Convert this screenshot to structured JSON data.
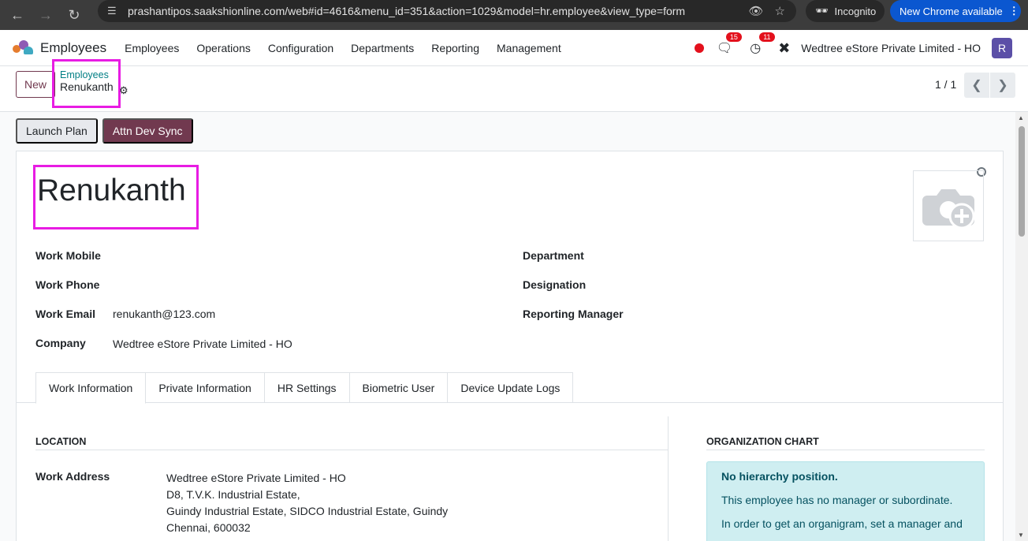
{
  "browser": {
    "url": "prashantipos.saakshionline.com/web#id=4616&menu_id=351&action=1029&model=hr.employee&view_type=form",
    "incognito_label": "Incognito",
    "update_label": "New Chrome available"
  },
  "topnav": {
    "app_name": "Employees",
    "menu": [
      "Employees",
      "Operations",
      "Configuration",
      "Departments",
      "Reporting",
      "Management"
    ],
    "messages_count": "15",
    "activities_count": "11",
    "company": "Wedtree eStore Private Limited - HO",
    "avatar_letter": "R"
  },
  "control_panel": {
    "new_label": "New",
    "breadcrumb_parent": "Employees",
    "breadcrumb_current": "Renukanth",
    "pager": "1 / 1"
  },
  "actions": {
    "launch_plan": "Launch Plan",
    "attn_dev_sync": "Attn Dev Sync"
  },
  "employee": {
    "name": "Renukanth",
    "fields_left": [
      {
        "label": "Work Mobile",
        "value": ""
      },
      {
        "label": "Work Phone",
        "value": ""
      },
      {
        "label": "Work Email",
        "value": "renukanth@123.com"
      },
      {
        "label": "Company",
        "value": "Wedtree eStore Private Limited - HO"
      }
    ],
    "fields_right": [
      {
        "label": "Department"
      },
      {
        "label": "Designation"
      },
      {
        "label": "Reporting Manager"
      }
    ]
  },
  "tabs": [
    "Work Information",
    "Private Information",
    "HR Settings",
    "Biometric User",
    "Device Update Logs"
  ],
  "location": {
    "section_title": "LOCATION",
    "work_address_label": "Work Address",
    "address_lines": [
      "Wedtree eStore Private Limited - HO",
      "D8, T.V.K. Industrial Estate,",
      "Guindy Industrial Estate, SIDCO Industrial Estate, Guindy",
      "Chennai, 600032"
    ]
  },
  "org_chart": {
    "section_title": "ORGANIZATION CHART",
    "alert_title": "No hierarchy position.",
    "alert_line1": "This employee has no manager or subordinate.",
    "alert_line2": "In order to get an organigram, set a manager and"
  },
  "colors": {
    "brand": "#71394f",
    "link": "#017e84",
    "highlight": "#e81ce3",
    "badge": "#e3101c"
  }
}
